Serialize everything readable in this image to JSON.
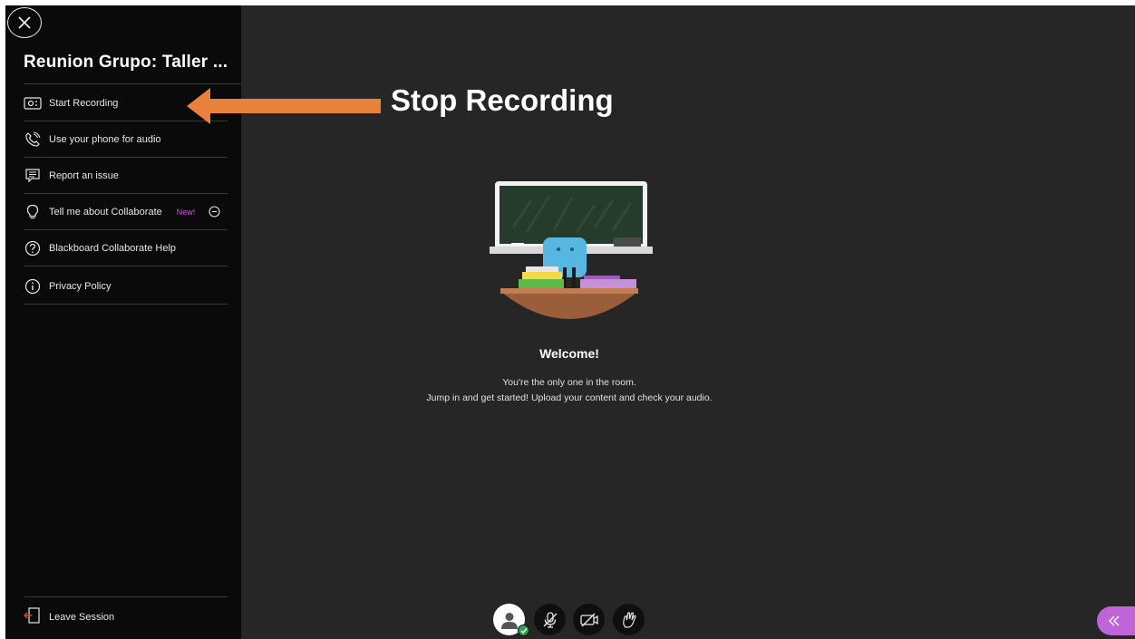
{
  "session": {
    "title": "Reunion Grupo: Taller ..."
  },
  "menu": {
    "items": [
      {
        "label": "Start Recording",
        "icon": "recording-camera-icon"
      },
      {
        "label": "Use your phone for audio",
        "icon": "phone-audio-icon"
      },
      {
        "label": "Report an issue",
        "icon": "report-issue-icon"
      },
      {
        "label": "Tell me about Collaborate",
        "icon": "lightbulb-icon",
        "badge": "New!"
      },
      {
        "label": "Blackboard Collaborate Help",
        "icon": "help-question-icon"
      },
      {
        "label": "Privacy Policy",
        "icon": "info-icon"
      }
    ],
    "leave_label": "Leave Session"
  },
  "annotation": {
    "text": "Stop Recording",
    "color": "#e8823a"
  },
  "welcome": {
    "heading": "Welcome!",
    "line1": "You're the only one in the room.",
    "line2": "Jump in and get started! Upload your content and check your audio."
  },
  "toolbar": {
    "buttons": [
      "avatar-icon",
      "microphone-muted-icon",
      "camera-off-icon",
      "raise-hand-icon"
    ],
    "panel_toggle_icon": "double-chevron-left-icon"
  },
  "colors": {
    "sidebar_bg": "#0a0a0a",
    "stage_bg": "#262626",
    "accent_purple": "#c064d9",
    "status_green": "#2e9e4f"
  }
}
